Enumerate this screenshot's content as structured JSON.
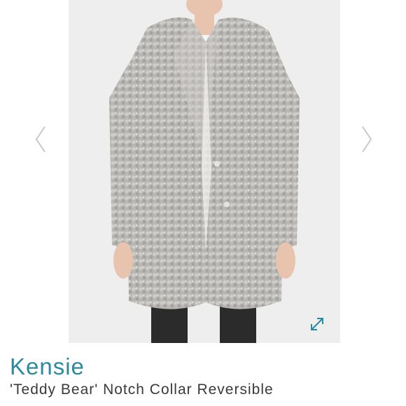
{
  "listing": {
    "brand": "Kensie",
    "title": "'Teddy Bear' Notch Collar Reversible"
  },
  "gallery": {
    "prev_icon": "chevron-left-icon",
    "next_icon": "chevron-right-icon",
    "expand_icon": "expand-diagonal-icon",
    "photo_subject": "grey teddy bear coat"
  },
  "colors": {
    "brand": "#2a8aa0",
    "title": "#3a3a3a",
    "photo_background": "#eeeeee",
    "coat": "#b8b6b2",
    "arrow": "#c8c8c8",
    "expand": "#2a8aa0"
  }
}
